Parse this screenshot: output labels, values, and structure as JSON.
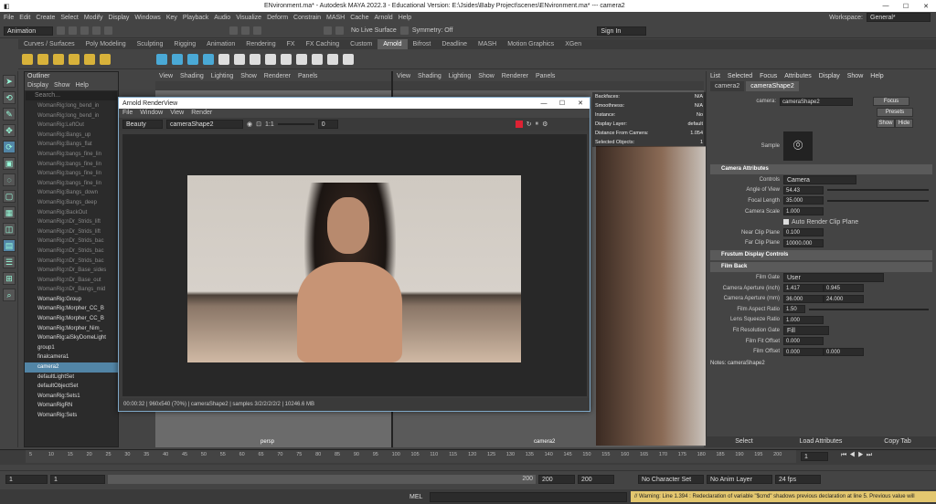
{
  "titlebar": {
    "title": "ENvironment.ma* - Autodesk MAYA 2022.3 - Educational Version: E:\\Jsides\\Baby Project\\scenes\\ENvironment.ma* --- camera2"
  },
  "menubar": {
    "items": [
      "File",
      "Edit",
      "Create",
      "Select",
      "Modify",
      "Display",
      "Windows",
      "Key",
      "Playback",
      "Audio",
      "Visualize",
      "Deform",
      "Constrain",
      "MASH",
      "Cache",
      "Arnold",
      "Help"
    ],
    "workspace_label": "Workspace:",
    "workspace_value": "General*"
  },
  "statusline": {
    "mode": "Animation",
    "surface": "No Live Surface",
    "symmetry": "Symmetry: Off",
    "sign_in": "Sign In"
  },
  "shelf": {
    "tabs": [
      "Curves / Surfaces",
      "Poly Modeling",
      "Sculpting",
      "Rigging",
      "Animation",
      "Rendering",
      "FX",
      "FX Caching",
      "Custom",
      "Arnold",
      "Bifrost",
      "Deadline",
      "MASH",
      "Motion Graphics",
      "XGen"
    ],
    "active_tab": "Arnold"
  },
  "outliner": {
    "title": "Outliner",
    "menu": [
      "Display",
      "Show",
      "Help"
    ],
    "search_placeholder": "Search...",
    "rows": [
      {
        "label": "WomanRig:long_bend_in",
        "lit": false
      },
      {
        "label": "WomanRig:long_bend_in",
        "lit": false
      },
      {
        "label": "WomanRig:LeftOut",
        "lit": false
      },
      {
        "label": "WomanRig:Bangs_up",
        "lit": false
      },
      {
        "label": "WomanRig:Bangs_flat",
        "lit": false
      },
      {
        "label": "WomanRig:bangs_fine_lin",
        "lit": false
      },
      {
        "label": "WomanRig:bangs_fine_lin",
        "lit": false
      },
      {
        "label": "WomanRig:bangs_fine_lin",
        "lit": false
      },
      {
        "label": "WomanRig:bangs_fine_lin",
        "lit": false
      },
      {
        "label": "WomanRig:Bangs_down",
        "lit": false
      },
      {
        "label": "WomanRig:Bangs_deep",
        "lit": false
      },
      {
        "label": "WomanRig:BackOut",
        "lit": false
      },
      {
        "label": "WomanRig:nDr_Strids_lift",
        "lit": false
      },
      {
        "label": "WomanRig:nDr_Strids_lift",
        "lit": false
      },
      {
        "label": "WomanRig:nDr_Strids_bac",
        "lit": false
      },
      {
        "label": "WomanRig:nDr_Strids_bac",
        "lit": false
      },
      {
        "label": "WomanRig:nDr_Strids_bac",
        "lit": false
      },
      {
        "label": "WomanRig:nDr_Base_sides",
        "lit": false
      },
      {
        "label": "WomanRig:nDr_Base_out",
        "lit": false
      },
      {
        "label": "WomanRig:nDr_Bangs_mid",
        "lit": false
      },
      {
        "label": "WomanRig:Group",
        "lit": true
      },
      {
        "label": "WomanRig:Morpher_CC_B",
        "lit": true
      },
      {
        "label": "WomanRig:Morpher_CC_B",
        "lit": true
      },
      {
        "label": "WomanRig:Morpher_Nim_",
        "lit": true
      },
      {
        "label": "WomanRig:aiSkyDomeLight",
        "lit": true
      },
      {
        "label": "group1",
        "lit": true
      },
      {
        "label": "finalcamera1",
        "lit": true
      },
      {
        "label": "camera2",
        "lit": true,
        "sel": true
      },
      {
        "label": "defaultLightSet",
        "lit": true
      },
      {
        "label": "defaultObjectSet",
        "lit": true
      },
      {
        "label": "WomanRig:Sets1",
        "lit": true
      },
      {
        "label": "WomanRigRN",
        "lit": true
      },
      {
        "label": "WomanRig:Sets",
        "lit": true
      }
    ]
  },
  "viewport": {
    "menu": [
      "View",
      "Shading",
      "Lighting",
      "Show",
      "Renderer",
      "Panels"
    ],
    "left_label": "persp",
    "right_label": "camera2",
    "hud": [
      {
        "k": "Backfaces:",
        "v": "N/A"
      },
      {
        "k": "Smoothness:",
        "v": "N/A"
      },
      {
        "k": "Instance:",
        "v": "No"
      },
      {
        "k": "Display Layer:",
        "v": "default"
      },
      {
        "k": "Distance From Camera:",
        "v": "1.054"
      },
      {
        "k": "Selected Objects:",
        "v": "1"
      }
    ]
  },
  "renderview": {
    "title": "Arnold RenderView",
    "menu": [
      "File",
      "Window",
      "View",
      "Render"
    ],
    "aov": "Beauty",
    "camera": "cameraShape2",
    "ratio": "1:1",
    "exposure": "0",
    "status": "00:00:32 | 960x540 (70%) | cameraShape2 | samples 3/2/2/2/2/2 | 10246.6 MB"
  },
  "attr": {
    "menu": [
      "List",
      "Selected",
      "Focus",
      "Attributes",
      "Display",
      "Show",
      "Help"
    ],
    "tabs": [
      "camera2",
      "cameraShape2"
    ],
    "active_tab": "cameraShape2",
    "node_label": "camera:",
    "node_value": "cameraShape2",
    "focus": "Focus",
    "presets": "Presets",
    "show": "Show",
    "hide": "Hide",
    "sample_label": "Sample",
    "sections": {
      "camera_attributes": "Camera Attributes",
      "frustum": "Frustum Display Controls",
      "film_back": "Film Back"
    },
    "controls_label": "Controls",
    "controls_value": "Camera",
    "angle_of_view_label": "Angle of View",
    "angle_of_view": "54.43",
    "focal_length_label": "Focal Length",
    "focal_length": "35.000",
    "camera_scale_label": "Camera Scale",
    "camera_scale": "1.000",
    "auto_clip": "Auto Render Clip Plane",
    "near_clip_label": "Near Clip Plane",
    "near_clip": "0.100",
    "far_clip_label": "Far Clip Plane",
    "far_clip": "10000.000",
    "film_gate_label": "Film Gate",
    "film_gate": "User",
    "aperture_in_label": "Camera Aperture (inch)",
    "aperture_in": [
      "1.417",
      "0.945"
    ],
    "aperture_mm_label": "Camera Aperture (mm)",
    "aperture_mm": [
      "36.000",
      "24.000"
    ],
    "film_aspect_label": "Film Aspect Ratio",
    "film_aspect": "1.50",
    "lens_squeeze_label": "Lens Squeeze Ratio",
    "lens_squeeze": "1.000",
    "fit_gate_label": "Fit Resolution Gate",
    "fit_gate": "Fill",
    "film_fit_offset_label": "Film Fit Offset",
    "film_fit_offset": "0.000",
    "film_offset_label": "Film Offset",
    "film_offset": [
      "0.000",
      "0.000"
    ],
    "notes": "Notes: cameraShape2",
    "buttons": [
      "Select",
      "Load Attributes",
      "Copy Tab"
    ]
  },
  "timeline": {
    "ticks": [
      "5",
      "10",
      "15",
      "20",
      "25",
      "30",
      "35",
      "40",
      "45",
      "50",
      "55",
      "60",
      "65",
      "70",
      "75",
      "80",
      "85",
      "90",
      "95",
      "100",
      "105",
      "110",
      "115",
      "120",
      "125",
      "130",
      "135",
      "140",
      "145",
      "150",
      "155",
      "160",
      "165",
      "170",
      "175",
      "180",
      "185",
      "190",
      "195",
      "200"
    ],
    "current_frame": "1"
  },
  "range": {
    "start": "1",
    "inner_start": "1",
    "inner_end": "200",
    "end": "200",
    "end2": "200",
    "char_set": "No Character Set",
    "anim_layer": "No Anim Layer",
    "fps": "24 fps"
  },
  "cmdline": {
    "lang": "MEL",
    "warning": "// Warning: Line 1.394 : Redeclaration of variable \"$cmd\" shadows previous declaration at line 5. Previous value will"
  }
}
